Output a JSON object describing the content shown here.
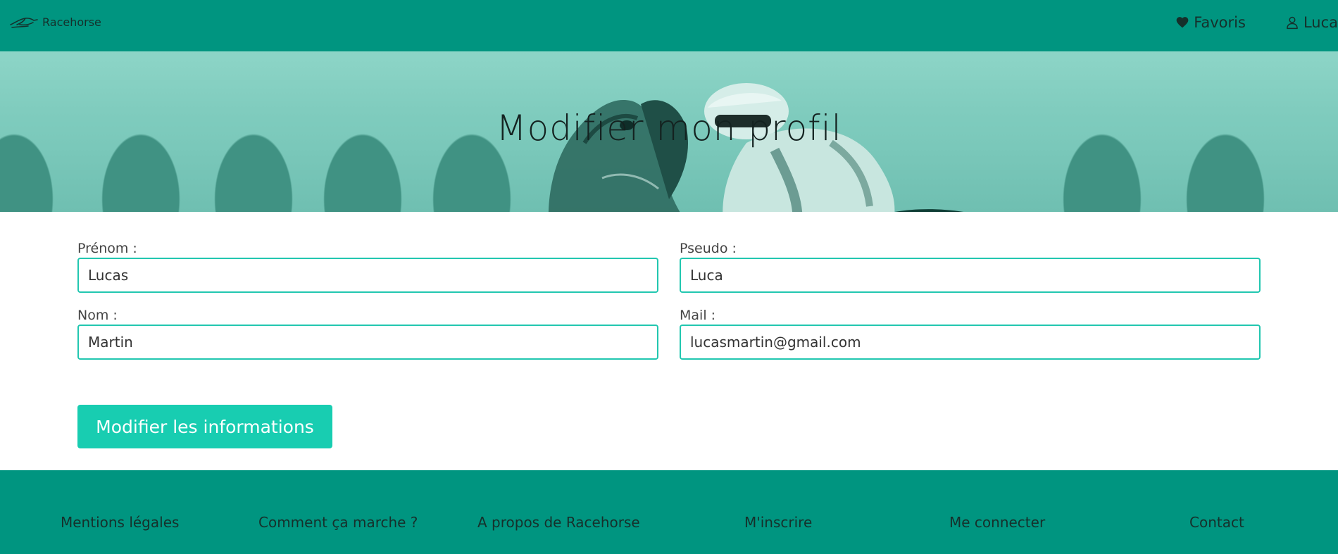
{
  "navbar": {
    "brand": "Racehorse",
    "favoris_label": "Favoris",
    "user_label": "Luca",
    "color": "#009580"
  },
  "hero": {
    "title": "Modifier mon profil"
  },
  "form": {
    "prenom": {
      "label": "Prénom :",
      "value": "Lucas"
    },
    "pseudo": {
      "label": "Pseudo :",
      "value": "Luca"
    },
    "nom": {
      "label": "Nom :",
      "value": "Martin"
    },
    "mail": {
      "label": "Mail :",
      "value": "lucasmartin@gmail.com"
    },
    "submit_label": "Modifier les informations",
    "accent": "#18cdb1"
  },
  "footer": {
    "links": [
      "Mentions légales",
      "Comment ça marche ?",
      "A propos de Racehorse",
      "M'inscrire",
      "Me connecter",
      "Contact"
    ]
  },
  "icons": {
    "brand": "horse-logo-icon",
    "favoris": "heart-icon",
    "user": "user-icon"
  }
}
